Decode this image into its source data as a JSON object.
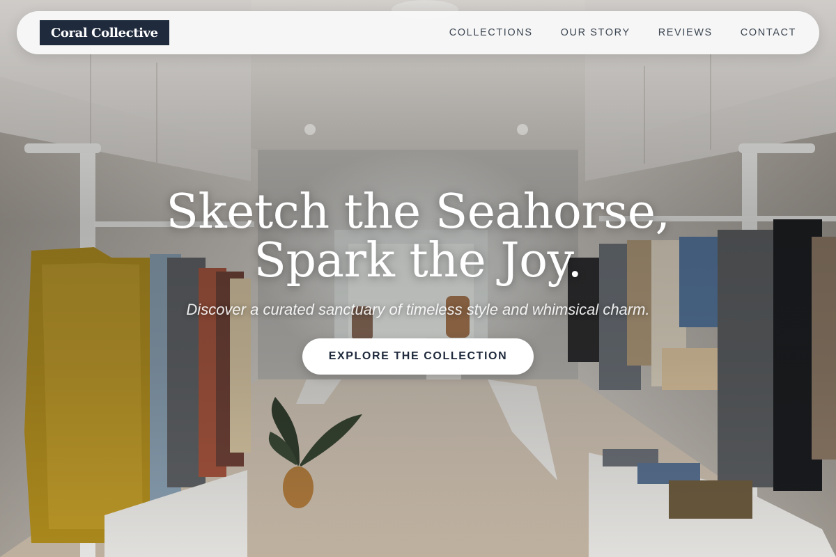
{
  "brand": {
    "name": "Coral Collective",
    "logo_bg": "#1f2a3c"
  },
  "nav": {
    "items": [
      {
        "label": "COLLECTIONS"
      },
      {
        "label": "OUR STORY"
      },
      {
        "label": "REVIEWS"
      },
      {
        "label": "CONTACT"
      }
    ]
  },
  "hero": {
    "headline_line1": "Sketch the Seahorse,",
    "headline_line2": "Spark the Joy.",
    "tagline": "Discover a curated sanctuary of timeless style and whimsical charm.",
    "cta_label": "EXPLORE THE COLLECTION",
    "background": "boutique-clothing-store-interior-photo"
  },
  "colors": {
    "navbar_bg": "#f8f8f8",
    "nav_text": "#3c4652",
    "cta_bg": "#ffffff",
    "cta_text": "#1f2a3c"
  }
}
